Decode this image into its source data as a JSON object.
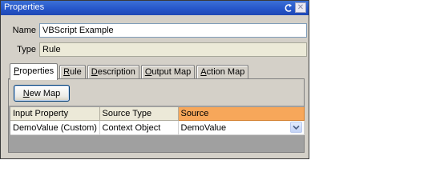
{
  "window": {
    "title": "Properties"
  },
  "fields": {
    "name_label": "Name",
    "name_value": "VBScript Example",
    "type_label": "Type",
    "type_value": "Rule"
  },
  "tabs": [
    {
      "u": "P",
      "rest": "roperties",
      "active": true
    },
    {
      "u": "R",
      "rest": "ule"
    },
    {
      "u": "D",
      "rest": "escription"
    },
    {
      "u": "O",
      "rest": "utput Map"
    },
    {
      "u": "A",
      "rest": "ction Map"
    }
  ],
  "toolbar": {
    "new_map_u": "N",
    "new_map_rest": "ew Map"
  },
  "table": {
    "headers": [
      "Input Property",
      "Source Type",
      "Source"
    ],
    "selected_header": 2,
    "rows": [
      [
        "DemoValue (Custom)",
        "Context Object",
        "DemoValue"
      ]
    ]
  },
  "colors": {
    "titlebar": "#2454c8",
    "selected_header": "#f7a75a",
    "panel_background": "#a0a0a0"
  }
}
